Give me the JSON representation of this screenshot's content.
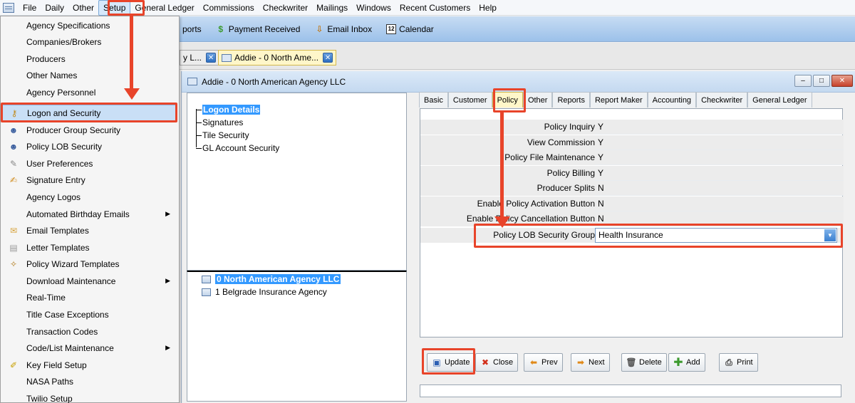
{
  "menubar": {
    "items": [
      "File",
      "Daily",
      "Other",
      "Setup",
      "General Ledger",
      "Commissions",
      "Checkwriter",
      "Mailings",
      "Windows",
      "Recent Customers",
      "Help"
    ],
    "active": "Setup"
  },
  "toolbar": {
    "reports_label": "ports",
    "payment_label": "Payment Received",
    "email_label": "Email Inbox",
    "calendar_label": "Calendar",
    "calendar_icon": "12"
  },
  "doc_tabs": [
    {
      "label": "y L..."
    },
    {
      "label": "Addie - 0  North Ame..."
    }
  ],
  "setup_menu": {
    "items": [
      {
        "label": "Agency Specifications",
        "icon": ""
      },
      {
        "label": "Companies/Brokers",
        "icon": ""
      },
      {
        "label": "Producers",
        "icon": ""
      },
      {
        "label": "Other Names",
        "icon": ""
      },
      {
        "label": "Agency Personnel",
        "icon": ""
      },
      {
        "label": "Logon and Security",
        "icon": "people-key-icon"
      },
      {
        "label": "Producer Group Security",
        "icon": "users-icon"
      },
      {
        "label": "Policy LOB Security",
        "icon": "users-icon"
      },
      {
        "label": "User Preferences",
        "icon": "pencil-icon"
      },
      {
        "label": "Signature Entry",
        "icon": "signature-icon"
      },
      {
        "label": "Agency Logos",
        "icon": ""
      },
      {
        "label": "Automated Birthday Emails",
        "icon": "",
        "submenu": true
      },
      {
        "label": "Email Templates",
        "icon": "envelope-icon"
      },
      {
        "label": "Letter Templates",
        "icon": "letter-icon"
      },
      {
        "label": "Policy Wizard Templates",
        "icon": "wand-icon"
      },
      {
        "label": "Download Maintenance",
        "icon": "",
        "submenu": true
      },
      {
        "label": "Real-Time",
        "icon": ""
      },
      {
        "label": "Title Case Exceptions",
        "icon": ""
      },
      {
        "label": "Transaction Codes",
        "icon": ""
      },
      {
        "label": "Code/List Maintenance",
        "icon": "",
        "submenu": true
      },
      {
        "label": "Key Field Setup",
        "icon": "pen-icon"
      },
      {
        "label": "NASA Paths",
        "icon": ""
      },
      {
        "label": "Twilio Setup",
        "icon": ""
      }
    ],
    "highlighted": "Logon and Security"
  },
  "window": {
    "title": "Addie - 0  North American Agency LLC",
    "buttons": {
      "minimize": "–",
      "maximize": "□",
      "close": "✕"
    }
  },
  "security_tree": {
    "items": [
      "Logon Details",
      "Signatures",
      "Tile Security",
      "GL Account Security"
    ],
    "selected": "Logon Details"
  },
  "agencies": {
    "items": [
      "0  North American Agency LLC",
      "1  Belgrade Insurance Agency"
    ],
    "selected": "0  North American Agency LLC"
  },
  "tabs": {
    "items": [
      "Basic",
      "Customer",
      "Policy",
      "Other",
      "Reports",
      "Report Maker",
      "Accounting",
      "Checkwriter",
      "General Ledger"
    ],
    "active": "Policy"
  },
  "policy_settings": [
    {
      "label": "Policy Inquiry",
      "value": "Y"
    },
    {
      "label": "View Commission",
      "value": "Y"
    },
    {
      "label": "Policy File Maintenance",
      "value": "Y"
    },
    {
      "label": "Policy Billing",
      "value": "Y"
    },
    {
      "label": "Producer Splits",
      "value": "N"
    },
    {
      "label": "Enable Policy Activation Button",
      "value": "N"
    },
    {
      "label": "Enable Policy Cancellation Button",
      "value": "N"
    }
  ],
  "lob_group": {
    "label": "Policy LOB Security Group",
    "value": "Health Insurance"
  },
  "actions": {
    "update": "Update",
    "close": "Close",
    "prev": "Prev",
    "next": "Next",
    "delete": "Delete",
    "add": "Add",
    "print": "Print"
  },
  "colors": {
    "annotation_red": "#e8442a",
    "selection_blue": "#3399ff",
    "active_tab_yellow": "#fff7c9",
    "toolbar_blue": "#9cc1ea"
  }
}
